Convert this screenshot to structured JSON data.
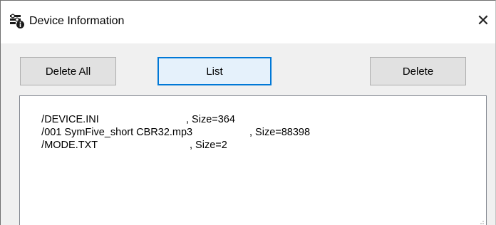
{
  "window": {
    "title": "Device Information",
    "close_label": "✕"
  },
  "toolbar": {
    "delete_all_label": "Delete All",
    "list_label": "List",
    "delete_label": "Delete"
  },
  "listbox": {
    "items": [
      {
        "name": "/DEVICE.INI",
        "size": ", Size=364"
      },
      {
        "name": "/001 SymFive_short CBR32.mp3",
        "size": ", Size=88398"
      },
      {
        "name": "/MODE.TXT",
        "size": ", Size=2"
      }
    ]
  }
}
